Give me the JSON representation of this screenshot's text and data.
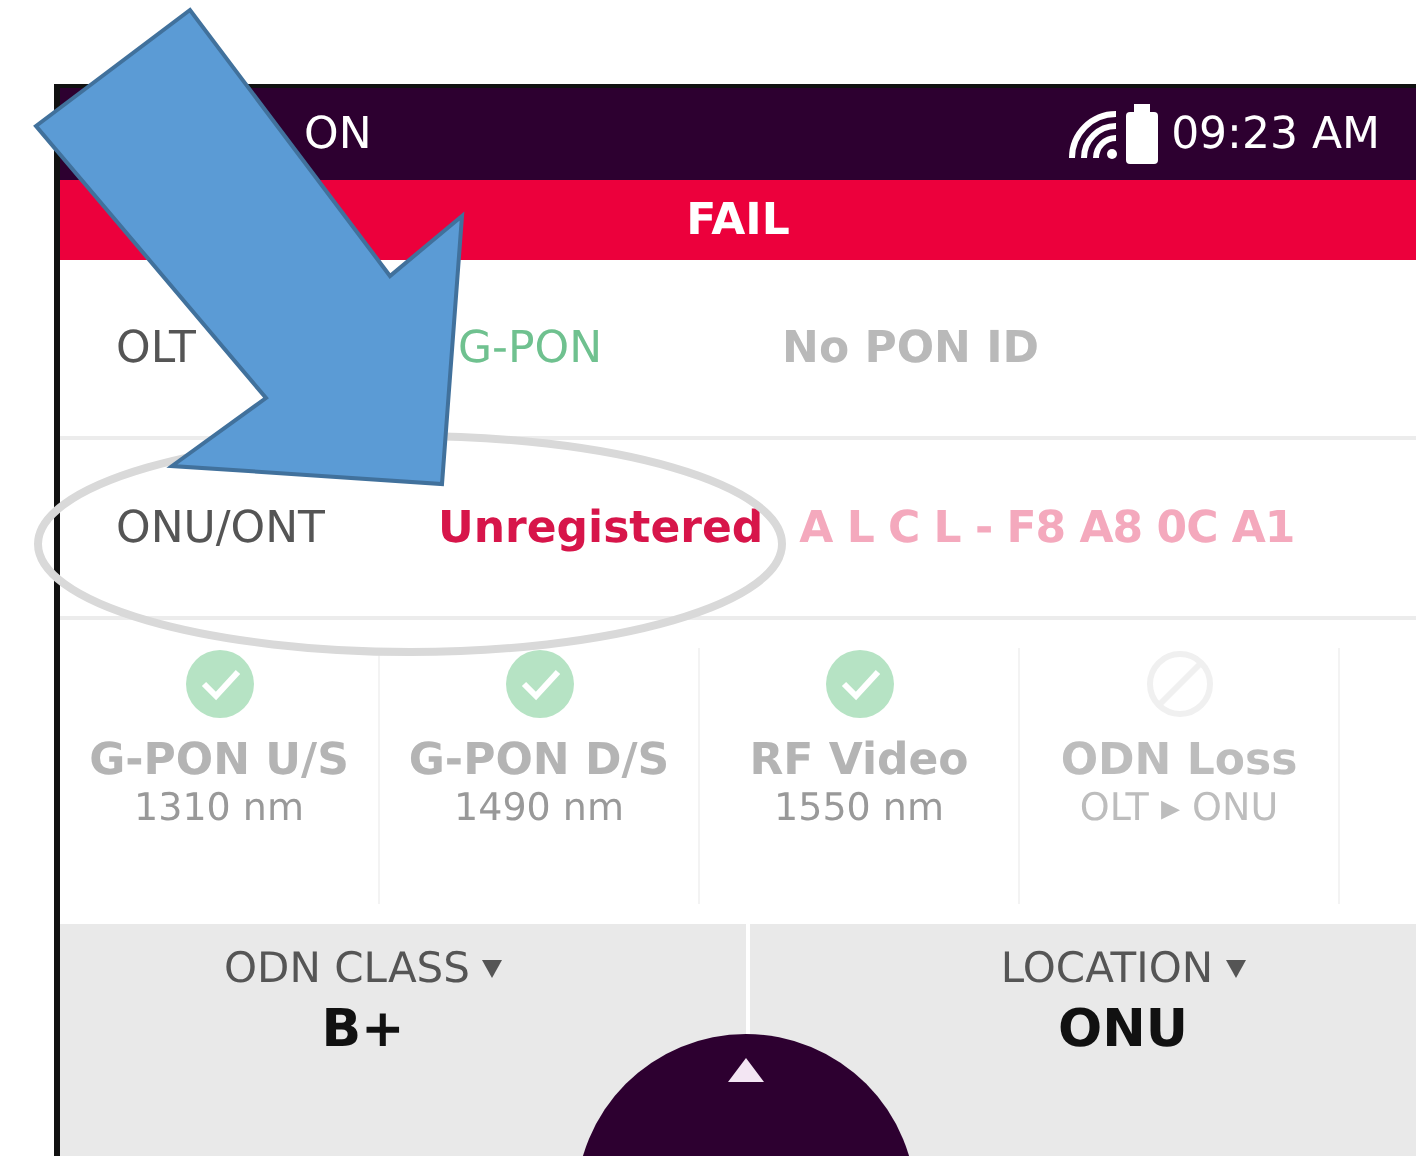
{
  "header": {
    "title": "ON",
    "time": "09:23 AM"
  },
  "result_banner": {
    "text": "FAIL",
    "failed": true
  },
  "info_rows": [
    {
      "label": "OLT",
      "value": "G-PON",
      "error": false,
      "detail": "No PON ID"
    },
    {
      "label": "ONU/ONT",
      "value": "Unregistered",
      "error": true,
      "detail": "A L C L - F8 A8 0C A1"
    }
  ],
  "tests": [
    {
      "name": "G-PON U/S",
      "wavelength": "1310 nm",
      "passed": true
    },
    {
      "name": "G-PON D/S",
      "wavelength": "1490 nm",
      "passed": true
    },
    {
      "name": "RF Video",
      "wavelength": "1550 nm",
      "passed": true
    },
    {
      "name": "ODN Loss",
      "wavelength": "OLT ▸ ONU",
      "passed": false
    }
  ],
  "selectors": [
    {
      "label": "ODN CLASS",
      "value": "B+"
    },
    {
      "label": "LOCATION",
      "value": "ONU"
    }
  ]
}
